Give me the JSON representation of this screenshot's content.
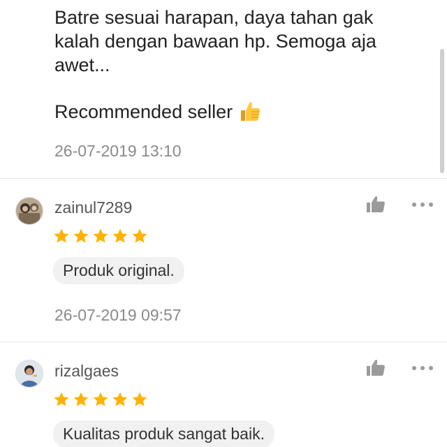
{
  "reviews_top": {
    "body": "Batre sesuai harapan, daya tahan gak kalah dengan bawaan hp. Semoga aja awet...",
    "recommend": "Recommended seller",
    "recommend_emoji": "thumbs-up-emoji",
    "timestamp": "26-07-2019 13:10"
  },
  "reviews": [
    {
      "username": "zainul7289",
      "rating": 5,
      "comment": "Produk original.",
      "timestamp": "26-07-2019 09:57"
    },
    {
      "username": "rizalgaes",
      "rating": 5,
      "comment": "Kualitas produk sangat baik."
    }
  ],
  "icons": {
    "like": "thumbs-up-icon",
    "more": "more-options-icon",
    "star": "star-icon"
  },
  "colors": {
    "star": "#FFB300",
    "text": "#222222",
    "muted": "#8a8a8a",
    "chip_bg": "#f1f1f1"
  }
}
